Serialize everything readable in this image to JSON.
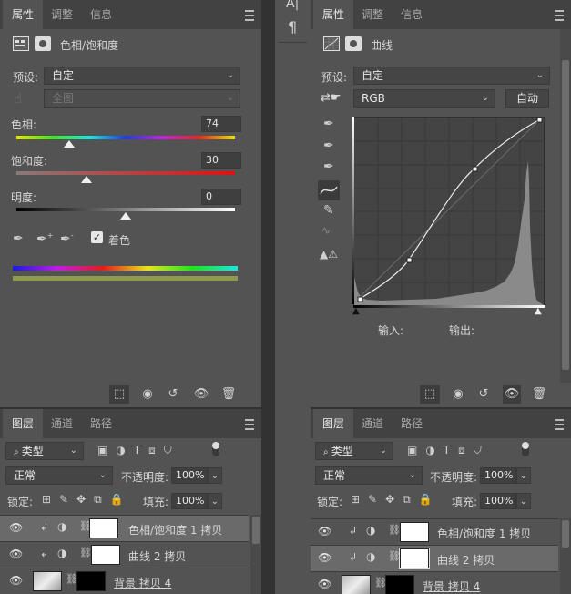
{
  "left_props": {
    "tabs": [
      "属性",
      "调整",
      "信息"
    ],
    "title": "色相/饱和度",
    "preset_label": "预设:",
    "preset_value": "自定",
    "channel_value": "全图",
    "hue_label": "色相:",
    "hue_value": "74",
    "hue_level": 0.24,
    "sat_label": "饱和度:",
    "sat_value": "30",
    "sat_level": 0.32,
    "light_label": "明度:",
    "light_value": "0",
    "light_level": 0.5,
    "colorize_label": "着色",
    "colorize_checked": true
  },
  "right_props": {
    "tabs": [
      "属性",
      "调整",
      "信息"
    ],
    "title": "曲线",
    "preset_label": "预设:",
    "preset_value": "自定",
    "channel_value": "RGB",
    "auto_label": "自动",
    "input_label": "输入:",
    "output_label": "输出:"
  },
  "left_layers": {
    "tabs": [
      "图层",
      "通道",
      "路径"
    ],
    "kind_value": "类型",
    "blend_value": "正常",
    "opacity_label": "不透明度:",
    "opacity_value": "100%",
    "lock_label": "锁定:",
    "fill_label": "填充:",
    "fill_value": "100%",
    "layers": [
      "色相/饱和度 1 拷贝",
      "曲线 2 拷贝",
      "背景 拷贝 4"
    ]
  },
  "right_layers": {
    "tabs": [
      "图层",
      "通道",
      "路径"
    ],
    "kind_value": "类型",
    "blend_value": "正常",
    "opacity_label": "不透明度:",
    "opacity_value": "100%",
    "lock_label": "锁定:",
    "fill_label": "填充:",
    "fill_value": "100%",
    "layers": [
      "色相/饱和度 1 拷贝",
      "曲线 2 拷贝",
      "背景 拷贝 4"
    ]
  },
  "middle_toolbar": {
    "char_icon": "A|",
    "para_icon": "¶"
  }
}
